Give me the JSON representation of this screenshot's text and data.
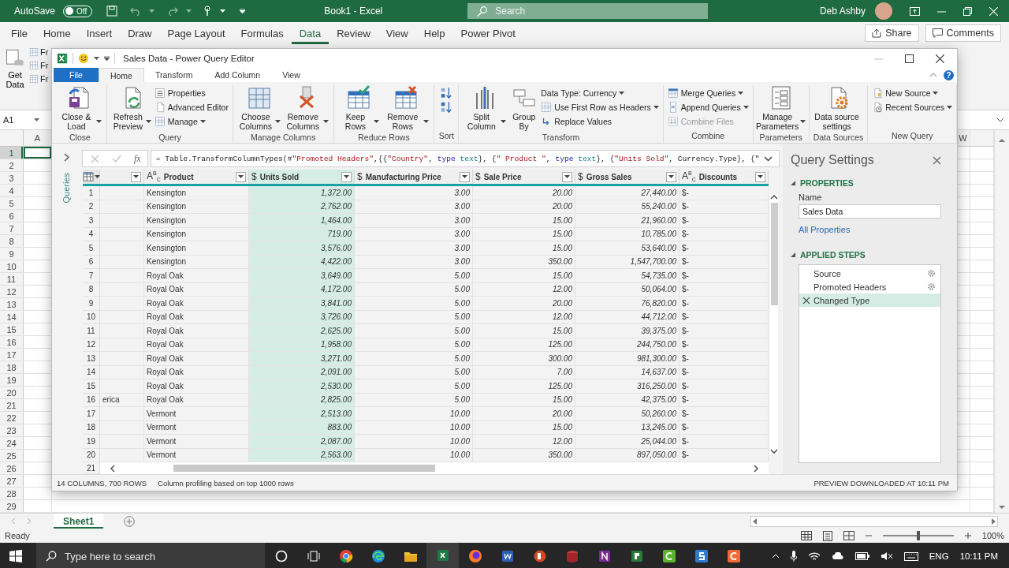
{
  "excel": {
    "title_bar": {
      "autosave_label": "AutoSave",
      "autosave_on": false,
      "autosave_state": "Off",
      "document_title": "Book1  -  Excel",
      "search_placeholder": "Search",
      "user_name": "Deb Ashby"
    },
    "menu_tabs": [
      {
        "label": "File",
        "selected": false
      },
      {
        "label": "Home",
        "selected": false
      },
      {
        "label": "Insert",
        "selected": false
      },
      {
        "label": "Draw",
        "selected": false
      },
      {
        "label": "Page Layout",
        "selected": false
      },
      {
        "label": "Formulas",
        "selected": false
      },
      {
        "label": "Data",
        "selected": true
      },
      {
        "label": "Review",
        "selected": false
      },
      {
        "label": "View",
        "selected": false
      },
      {
        "label": "Help",
        "selected": false
      },
      {
        "label": "Power Pivot",
        "selected": false
      }
    ],
    "share_label": "Share",
    "comments_label": "Comments",
    "ribbon": {
      "get_data_label": "Get Data",
      "cut_labels": [
        "Fr",
        "Fr",
        "Fr"
      ]
    },
    "name_box": "A1",
    "left_column": "A",
    "right_column": "W",
    "row_numbers": [
      "1",
      "2",
      "3",
      "4",
      "5",
      "6",
      "7",
      "8",
      "9",
      "10",
      "11",
      "12",
      "13",
      "14",
      "15",
      "16",
      "17",
      "18",
      "19",
      "20",
      "21",
      "22",
      "23",
      "24",
      "25",
      "26",
      "27",
      "28",
      "29"
    ],
    "sheet_tabs": [
      {
        "label": "Sheet1",
        "selected": true
      }
    ],
    "status": "Ready",
    "zoom": {
      "label": "100%",
      "level": 0.5
    }
  },
  "power_query": {
    "window_title": "Sales Data - Power Query Editor",
    "help_label": "?",
    "tabs": [
      {
        "label": "File",
        "kind": "file",
        "selected": false
      },
      {
        "label": "Home",
        "kind": "tab",
        "selected": true
      },
      {
        "label": "Transform",
        "kind": "tab",
        "selected": false
      },
      {
        "label": "Add Column",
        "kind": "tab",
        "selected": false
      },
      {
        "label": "View",
        "kind": "tab",
        "selected": false
      }
    ],
    "ribbon_groups": [
      {
        "label": "Close",
        "items": [
          {
            "kind": "large",
            "label": "Close & Load",
            "dropdown": true
          }
        ]
      },
      {
        "label": "Query",
        "items": [
          {
            "kind": "large",
            "label": "Refresh Preview",
            "dropdown": true
          },
          {
            "kind": "small",
            "label": "Properties",
            "dropdown": false
          },
          {
            "kind": "small",
            "label": "Advanced Editor",
            "dropdown": false
          },
          {
            "kind": "small",
            "label": "Manage",
            "dropdown": true
          }
        ]
      },
      {
        "label": "Manage Columns",
        "items": [
          {
            "kind": "large",
            "label": "Choose Columns",
            "dropdown": true
          },
          {
            "kind": "large",
            "label": "Remove Columns",
            "dropdown": true
          }
        ]
      },
      {
        "label": "Reduce Rows",
        "items": [
          {
            "kind": "large",
            "label": "Keep Rows",
            "dropdown": true
          },
          {
            "kind": "large",
            "label": "Remove Rows",
            "dropdown": true
          }
        ]
      },
      {
        "label": "Sort",
        "items": [
          {
            "kind": "icon"
          },
          {
            "kind": "icon"
          }
        ]
      },
      {
        "label": "Transform",
        "items": [
          {
            "kind": "large",
            "label": "Split Column",
            "dropdown": true
          },
          {
            "kind": "large",
            "label": "Group By",
            "dropdown": false
          },
          {
            "kind": "small",
            "label": "Data Type: Currency",
            "dropdown": true
          },
          {
            "kind": "small",
            "label": "Use First Row as Headers",
            "dropdown": true
          },
          {
            "kind": "small",
            "label": "Replace Values",
            "dropdown": false
          }
        ]
      },
      {
        "label": "Combine",
        "items": [
          {
            "kind": "small",
            "label": "Merge Queries",
            "dropdown": true
          },
          {
            "kind": "small",
            "label": "Append Queries",
            "dropdown": true
          },
          {
            "kind": "small",
            "label": "Combine Files",
            "dropdown": false,
            "disabled": true
          }
        ]
      },
      {
        "label": "Parameters",
        "items": [
          {
            "kind": "large",
            "label": "Manage Parameters",
            "dropdown": true
          }
        ]
      },
      {
        "label": "Data Sources",
        "items": [
          {
            "kind": "large",
            "label": "Data source settings",
            "dropdown": false
          }
        ]
      },
      {
        "label": "New Query",
        "items": [
          {
            "kind": "small",
            "label": "New Source",
            "dropdown": true
          },
          {
            "kind": "small",
            "label": "Recent Sources",
            "dropdown": true
          }
        ]
      }
    ],
    "queries_pane": {
      "label": "Queries",
      "expanded": false
    },
    "formula": {
      "fx_label": "fx",
      "segments": [
        {
          "kind": "plain",
          "text": "= Table.TransformColumnTypes(#"
        },
        {
          "kind": "string",
          "text": "\"Promoted Headers\""
        },
        {
          "kind": "plain",
          "text": ",{{"
        },
        {
          "kind": "string",
          "text": "\"Country\""
        },
        {
          "kind": "plain",
          "text": ", "
        },
        {
          "kind": "keyword",
          "text": "type"
        },
        {
          "kind": "typename",
          "text": " text"
        },
        {
          "kind": "plain",
          "text": "}, {"
        },
        {
          "kind": "string",
          "text": "\" Product \""
        },
        {
          "kind": "plain",
          "text": ", "
        },
        {
          "kind": "keyword",
          "text": "type"
        },
        {
          "kind": "typename",
          "text": " text"
        },
        {
          "kind": "plain",
          "text": "}, {"
        },
        {
          "kind": "string",
          "text": "\"Units Sold\""
        },
        {
          "kind": "plain",
          "text": ", Currency.Type}, {\""
        }
      ]
    },
    "grid": {
      "columns": [
        {
          "kind": "text",
          "selected": false
        },
        {
          "kind": "text",
          "type_icon": "A$^{B}$$_{C}$",
          "label": "Product",
          "selected": false
        },
        {
          "kind": "currency",
          "type_icon": "$",
          "label": "Units Sold",
          "selected": true
        },
        {
          "kind": "currency",
          "type_icon": "$",
          "label": "Manufacturing Price",
          "selected": false
        },
        {
          "kind": "currency",
          "type_icon": "$",
          "label": "Sale Price",
          "selected": false
        },
        {
          "kind": "currency",
          "type_icon": "$",
          "label": "Gross Sales",
          "selected": false
        },
        {
          "kind": "text",
          "type_icon": "A$^{B}$$_{C}$",
          "label": "Discounts",
          "selected": false
        }
      ],
      "rows": [
        {
          "number": "1",
          "cells": [
            null,
            "Kensington",
            "1,372.00",
            "3.00",
            "20.00",
            "27,440.00",
            "$-"
          ]
        },
        {
          "number": "2",
          "cells": [
            null,
            "Kensington",
            "2,762.00",
            "3.00",
            "20.00",
            "55,240.00",
            "$-"
          ]
        },
        {
          "number": "3",
          "cells": [
            null,
            "Kensington",
            "1,464.00",
            "3.00",
            "15.00",
            "21,960.00",
            "$-"
          ]
        },
        {
          "number": "4",
          "cells": [
            null,
            "Kensington",
            "719.00",
            "3.00",
            "15.00",
            "10,785.00",
            "$-"
          ]
        },
        {
          "number": "5",
          "cells": [
            null,
            "Kensington",
            "3,576.00",
            "3.00",
            "15.00",
            "53,640.00",
            "$-"
          ]
        },
        {
          "number": "6",
          "cells": [
            null,
            "Kensington",
            "4,422.00",
            "3.00",
            "350.00",
            "1,547,700.00",
            "$-"
          ]
        },
        {
          "number": "7",
          "cells": [
            null,
            "Royal Oak",
            "3,649.00",
            "5.00",
            "15.00",
            "54,735.00",
            "$-"
          ]
        },
        {
          "number": "8",
          "cells": [
            null,
            "Royal Oak",
            "4,172.00",
            "5.00",
            "12.00",
            "50,064.00",
            "$-"
          ]
        },
        {
          "number": "9",
          "cells": [
            null,
            "Royal Oak",
            "3,841.00",
            "5.00",
            "20.00",
            "76,820.00",
            "$-"
          ]
        },
        {
          "number": "10",
          "cells": [
            null,
            "Royal Oak",
            "3,726.00",
            "5.00",
            "12.00",
            "44,712.00",
            "$-"
          ]
        },
        {
          "number": "11",
          "cells": [
            null,
            "Royal Oak",
            "2,625.00",
            "5.00",
            "15.00",
            "39,375.00",
            "$-"
          ]
        },
        {
          "number": "12",
          "cells": [
            null,
            "Royal Oak",
            "1,958.00",
            "5.00",
            "125.00",
            "244,750.00",
            "$-"
          ]
        },
        {
          "number": "13",
          "cells": [
            null,
            "Royal Oak",
            "3,271.00",
            "5.00",
            "300.00",
            "981,300.00",
            "$-"
          ]
        },
        {
          "number": "14",
          "cells": [
            null,
            "Royal Oak",
            "2,091.00",
            "5.00",
            "7.00",
            "14,637.00",
            "$-"
          ]
        },
        {
          "number": "15",
          "cells": [
            null,
            "Royal Oak",
            "2,530.00",
            "5.00",
            "125.00",
            "316,250.00",
            "$-"
          ]
        },
        {
          "number": "16",
          "cells": [
            "erica",
            "Royal Oak",
            "2,825.00",
            "5.00",
            "15.00",
            "42,375.00",
            "$-"
          ]
        },
        {
          "number": "17",
          "cells": [
            null,
            "Vermont",
            "2,513.00",
            "10.00",
            "20.00",
            "50,260.00",
            "$-"
          ]
        },
        {
          "number": "18",
          "cells": [
            null,
            "Vermont",
            "883.00",
            "10.00",
            "15.00",
            "13,245.00",
            "$-"
          ]
        },
        {
          "number": "19",
          "cells": [
            null,
            "Vermont",
            "2,087.00",
            "10.00",
            "12.00",
            "25,044.00",
            "$-"
          ]
        },
        {
          "number": "20",
          "cells": [
            null,
            "Vermont",
            "2,563.00",
            "10.00",
            "350.00",
            "897,050.00",
            "$-"
          ]
        }
      ],
      "partial_row_number": "21"
    },
    "settings": {
      "title": "Query Settings",
      "properties": {
        "heading": "PROPERTIES",
        "expanded": true
      },
      "name_label": "Name",
      "name_value": "Sales Data",
      "all_properties_link": "All Properties",
      "applied_steps": {
        "heading": "APPLIED STEPS",
        "expanded": true
      },
      "steps": [
        {
          "label": "Source",
          "selected": false,
          "has_settings": true
        },
        {
          "label": "Promoted Headers",
          "selected": false,
          "has_settings": true
        },
        {
          "label": "Changed Type",
          "selected": true,
          "has_settings": false
        }
      ]
    },
    "status": {
      "counts": "14 COLUMNS, 700 ROWS",
      "profiling": "Column profiling based on top 1000 rows",
      "preview": "PREVIEW DOWNLOADED AT 10:11 PM"
    }
  },
  "taskbar": {
    "search_placeholder": "Type here to search",
    "apps": [
      {
        "kind": "chrome",
        "active": false
      },
      {
        "kind": "edge",
        "active": false
      },
      {
        "kind": "explorer",
        "active": false
      },
      {
        "kind": "excel",
        "active": true
      },
      {
        "kind": "firefox",
        "active": false
      },
      {
        "kind": "word",
        "active": false
      },
      {
        "kind": "powerpoint",
        "active": false
      },
      {
        "kind": "access",
        "active": false
      },
      {
        "kind": "onenote",
        "active": false
      },
      {
        "kind": "project",
        "active": false
      },
      {
        "kind": "camtasia",
        "active": false
      },
      {
        "kind": "snagit",
        "active": false
      },
      {
        "kind": "recorder",
        "active": false
      }
    ],
    "language": "ENG",
    "time": "10:11 PM"
  }
}
